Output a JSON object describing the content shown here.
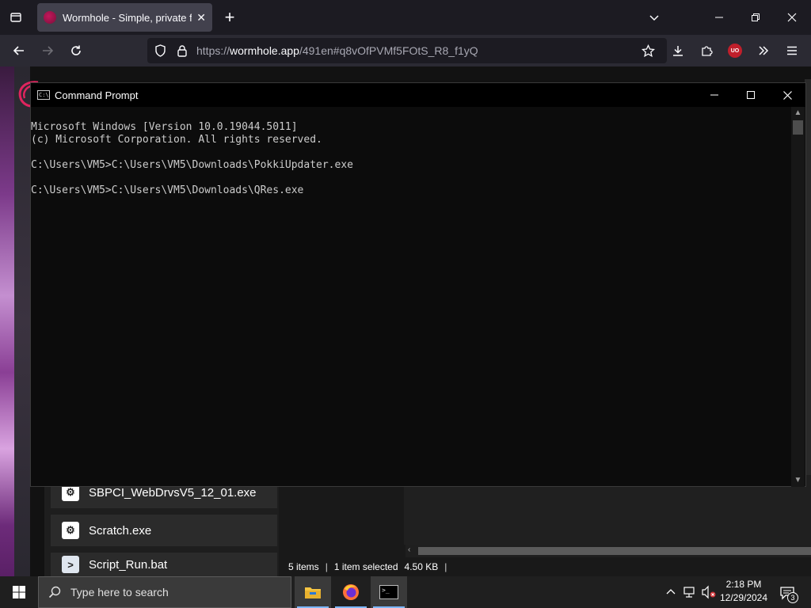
{
  "browser": {
    "tab_title": "Wormhole - Simple, private file",
    "url_prefix": "https://",
    "url_host": "wormhole.app",
    "url_rest": "/491en#q8vOfPVMf5FOtS_R8_f1yQ",
    "extension_badge": "UO"
  },
  "cmd": {
    "title": "Command Prompt",
    "icon_text": "C:\\",
    "lines": [
      "Microsoft Windows [Version 10.0.19044.5011]",
      "(c) Microsoft Corporation. All rights reserved.",
      "",
      "C:\\Users\\VM5>C:\\Users\\VM5\\Downloads\\PokkiUpdater.exe",
      "",
      "C:\\Users\\VM5>C:\\Users\\VM5\\Downloads\\QRes.exe"
    ]
  },
  "explorer": {
    "files": [
      {
        "name": "SBPCI_WebDrvsV5_12_01.exe",
        "icon": "gear-icon"
      },
      {
        "name": "Scratch.exe",
        "icon": "gear-icon"
      },
      {
        "name": "Script_Run.bat",
        "icon": "batch-file-icon"
      }
    ],
    "status_items": "5 items",
    "status_selected": "1 item selected",
    "status_size": "4.50 KB"
  },
  "taskbar": {
    "search_placeholder": "Type here to search",
    "time": "2:18 PM",
    "date": "12/29/2024",
    "notification_count": "3"
  }
}
